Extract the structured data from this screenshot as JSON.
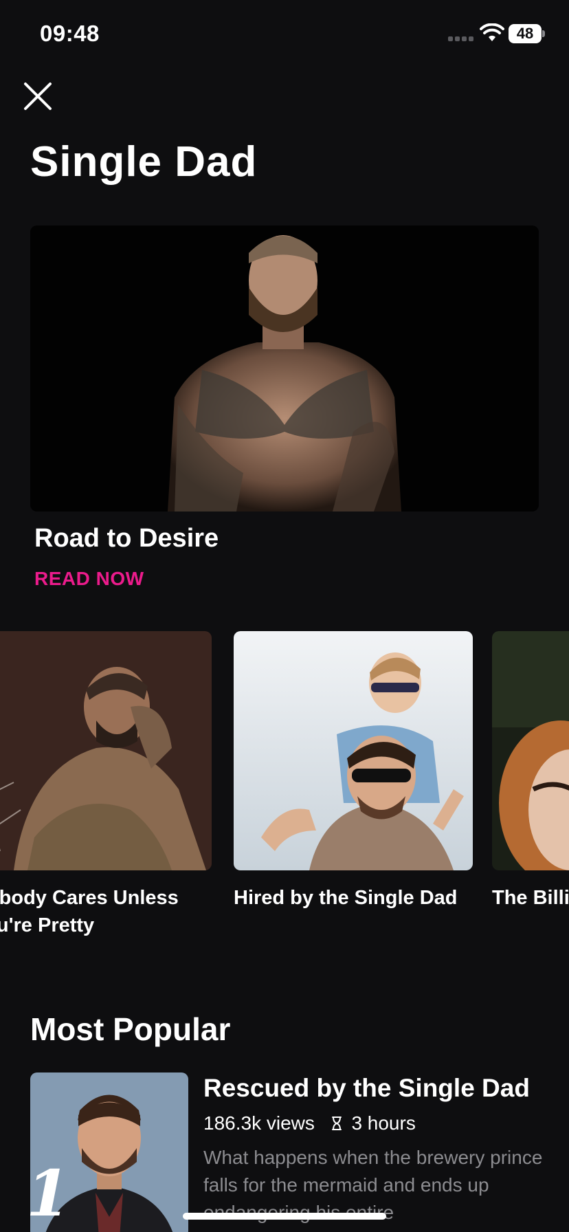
{
  "status_bar": {
    "time": "09:48",
    "battery": "48"
  },
  "header": {
    "title": "Single Dad"
  },
  "hero": {
    "title": "Road to Desire",
    "cta": "READ NOW"
  },
  "carousel": {
    "items": [
      {
        "title": "Nobody Cares Unless You're Pretty"
      },
      {
        "title": "Hired by the Single Dad"
      },
      {
        "title": "The Billi"
      }
    ]
  },
  "most_popular": {
    "title": "Most Popular",
    "items": [
      {
        "rank": "1",
        "title": "Rescued by the Single Dad",
        "views": "186.3k views",
        "duration": "3 hours",
        "description": "What happens when the brewery prince falls for the mermaid and ends up endangering his entire"
      }
    ]
  },
  "colors": {
    "accent": "#ec1b8c",
    "background": "#0e0e10",
    "muted_text": "#8c8c90"
  }
}
